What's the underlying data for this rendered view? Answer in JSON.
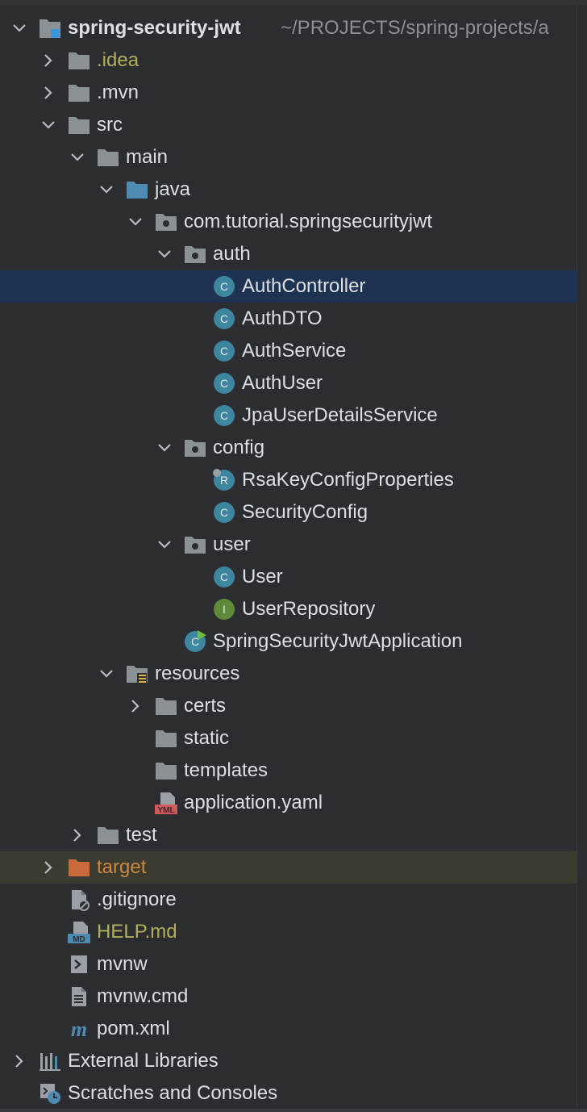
{
  "project": {
    "name": "spring-security-jwt",
    "path": "~/PROJECTS/spring-projects/a"
  },
  "rows": [
    {
      "label": "spring-security-jwt",
      "icon": "project-folder-icon",
      "depth": 0,
      "expanded": true
    },
    {
      "label": ".idea",
      "icon": "folder-icon",
      "depth": 1,
      "collapsed": true
    },
    {
      "label": ".mvn",
      "icon": "folder-icon",
      "depth": 1,
      "collapsed": true
    },
    {
      "label": "src",
      "icon": "folder-icon",
      "depth": 1,
      "expanded": true
    },
    {
      "label": "main",
      "icon": "folder-icon",
      "depth": 2,
      "expanded": true
    },
    {
      "label": "java",
      "icon": "source-folder-icon",
      "depth": 3,
      "expanded": true
    },
    {
      "label": "com.tutorial.springsecurityjwt",
      "icon": "package-icon",
      "depth": 4,
      "expanded": true
    },
    {
      "label": "auth",
      "icon": "package-icon",
      "depth": 5,
      "expanded": true
    },
    {
      "label": "AuthController",
      "icon": "class-icon",
      "depth": 6,
      "selected": true
    },
    {
      "label": "AuthDTO",
      "icon": "class-icon",
      "depth": 6
    },
    {
      "label": "AuthService",
      "icon": "class-icon",
      "depth": 6
    },
    {
      "label": "AuthUser",
      "icon": "class-icon",
      "depth": 6
    },
    {
      "label": "JpaUserDetailsService",
      "icon": "class-icon",
      "depth": 6
    },
    {
      "label": "config",
      "icon": "package-icon",
      "depth": 5,
      "expanded": true
    },
    {
      "label": "RsaKeyConfigProperties",
      "icon": "record-icon",
      "depth": 6
    },
    {
      "label": "SecurityConfig",
      "icon": "class-icon",
      "depth": 6
    },
    {
      "label": "user",
      "icon": "package-icon",
      "depth": 5,
      "expanded": true
    },
    {
      "label": "User",
      "icon": "class-icon",
      "depth": 6
    },
    {
      "label": "UserRepository",
      "icon": "interface-icon",
      "depth": 6
    },
    {
      "label": "SpringSecurityJwtApplication",
      "icon": "spring-app-class-icon",
      "depth": 5
    },
    {
      "label": "resources",
      "icon": "resources-folder-icon",
      "depth": 3,
      "expanded": true
    },
    {
      "label": "certs",
      "icon": "folder-icon",
      "depth": 4,
      "collapsed": true
    },
    {
      "label": "static",
      "icon": "folder-icon",
      "depth": 4
    },
    {
      "label": "templates",
      "icon": "folder-icon",
      "depth": 4
    },
    {
      "label": "application.yaml",
      "icon": "yaml-file-icon",
      "depth": 4
    },
    {
      "label": "test",
      "icon": "folder-icon",
      "depth": 2,
      "collapsed": true
    },
    {
      "label": "target",
      "icon": "excluded-folder-icon",
      "depth": 1,
      "collapsed": true
    },
    {
      "label": ".gitignore",
      "icon": "ignore-file-icon",
      "depth": 1
    },
    {
      "label": "HELP.md",
      "icon": "markdown-file-icon",
      "depth": 1
    },
    {
      "label": "mvnw",
      "icon": "script-file-icon",
      "depth": 1
    },
    {
      "label": "mvnw.cmd",
      "icon": "text-file-icon",
      "depth": 1
    },
    {
      "label": "pom.xml",
      "icon": "maven-icon",
      "depth": 1
    },
    {
      "label": "External Libraries",
      "icon": "libraries-icon",
      "depth": 0,
      "collapsed": true
    },
    {
      "label": "Scratches and Consoles",
      "icon": "scratches-icon",
      "depth": 0
    }
  ],
  "colors": {
    "background": "#2b2d30",
    "selection": "#1e3352",
    "excluded_row": "#3d3a30",
    "text": "#dcdfe4",
    "untracked_text": "#b3ae5a",
    "excluded_text": "#c8893f",
    "class_icon": "#3e86a0",
    "interface_icon": "#5f8a3c",
    "folder_icon": "#8c9196",
    "source_folder_icon": "#4f8ab2",
    "excluded_folder_icon": "#c86a3a"
  }
}
